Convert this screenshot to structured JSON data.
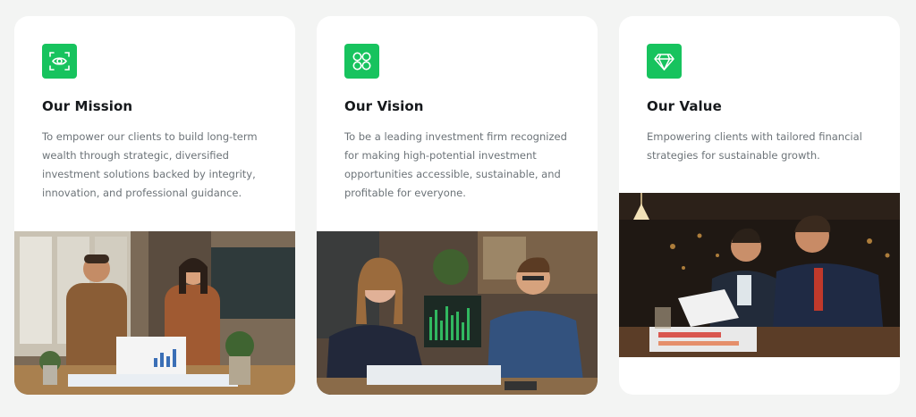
{
  "cards": [
    {
      "title": "Our Mission",
      "text": "To empower our clients to build long-term wealth through strategic, diversified investment solutions backed by integrity, innovation, and professional guidance.",
      "icon": "eye-target-icon",
      "image": "two-colleagues-reviewing-charts"
    },
    {
      "title": "Our Vision",
      "text": "To be a leading investment firm recognized for making high-potential investment opportunities accessible, sustainable, and profitable for everyone.",
      "icon": "four-circles-icon",
      "image": "smiling-team-with-trading-screen"
    },
    {
      "title": "Our Value",
      "text": "Empowering clients with tailored financial strategies for sustainable growth.",
      "icon": "diamond-icon",
      "image": "businessmen-reviewing-report"
    }
  ],
  "colors": {
    "accent": "#17c35e",
    "background": "#f3f4f3",
    "card": "#ffffff",
    "title": "#16191c",
    "body_text": "#6c7378"
  }
}
